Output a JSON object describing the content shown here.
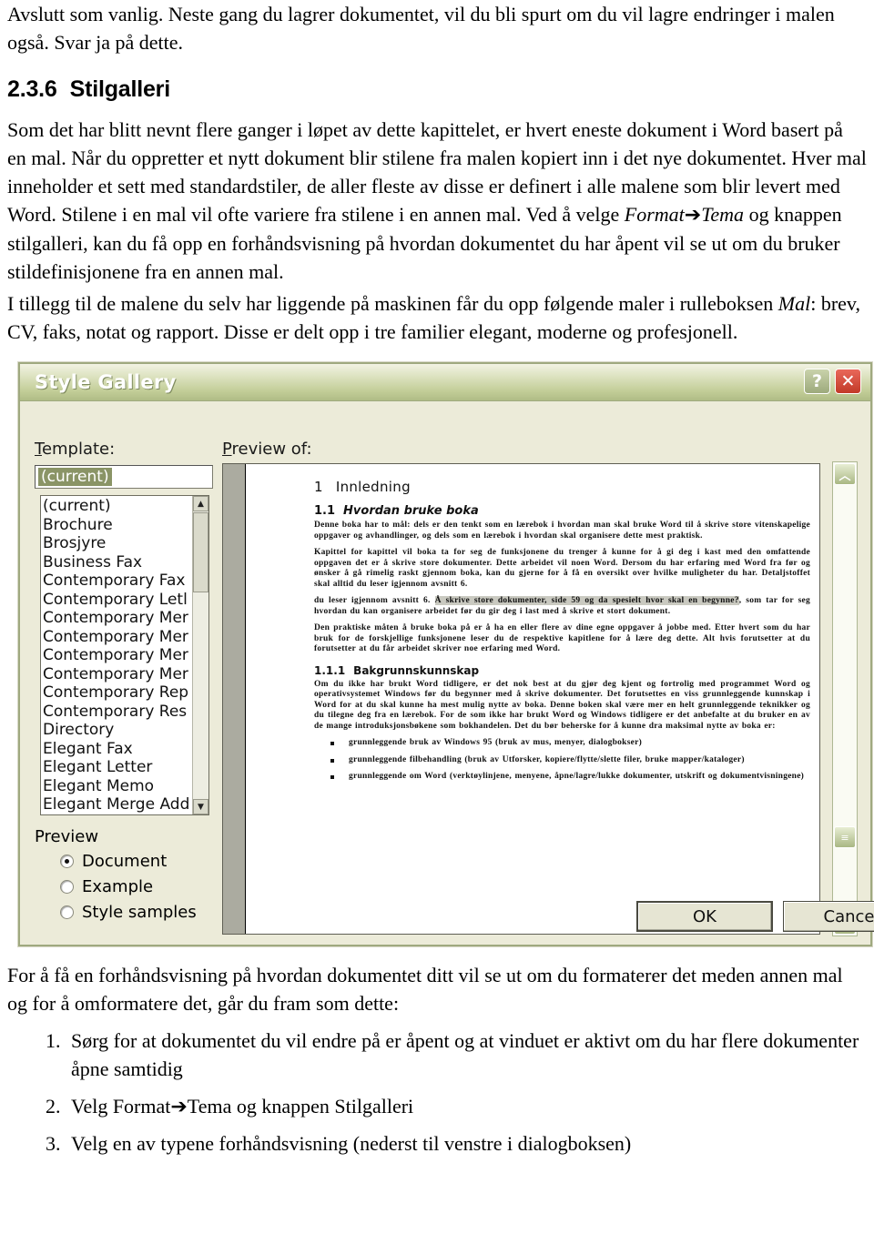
{
  "document": {
    "intro_paragraph": "Avslutt som vanlig. Neste gang du lagrer dokumentet, vil du bli spurt om du vil lagre endringer i malen også. Svar ja på dette.",
    "heading": {
      "number": "2.3.6",
      "title": "Stilgalleri"
    },
    "body_1_a": "Som det har blitt nevnt flere ganger i løpet av dette kapittelet, er hvert eneste dokument i Word basert på en mal. Når du oppretter et nytt dokument blir stilene fra malen kopiert inn i det nye dokumentet. Hver mal inneholder et sett med standardstiler, de aller fleste av disse er definert i alle malene som blir levert med Word. Stilene i en mal vil ofte variere fra stilene i en annen mal. Ved å velge ",
    "body_1_fmt": "Format",
    "body_1_arrow": "➔",
    "body_1_tema": "Tema",
    "body_1_b": " og knappen stilgalleri, kan du få opp en forhåndsvisning på hvordan dokumentet du har åpent vil se ut om du bruker stildefinisjonene fra en annen mal.",
    "body_2_a": "I tillegg til de malene du selv har liggende på maskinen får du opp følgende maler i rulleboksen ",
    "body_2_mal": "Mal",
    "body_2_b": ": brev, CV, faks, notat og rapport. Disse er delt opp i tre familier elegant, moderne og profesjonell.",
    "after_image_paragraph": "For å få en forhåndsvisning på hvordan dokumentet ditt vil se ut om du formaterer det meden annen mal og for å omformatere det, går du fram som dette:",
    "steps": [
      "Sørg for at dokumentet du vil endre på er åpent og at vinduet er aktivt om du har flere dokumenter åpne samtidig",
      "Velg Format➔Tema og knappen Stilgalleri",
      "Velg en av typene forhåndsvisning (nederst til venstre i dialogboksen)"
    ]
  },
  "dialog": {
    "title": "Style Gallery",
    "help_button": "?",
    "close_button": "✕",
    "template_label": "Template:",
    "template_value": "(current)",
    "preview_of_label": "Preview of:",
    "template_list": [
      "(current)",
      "Brochure",
      "Brosjyre",
      "Business Fax",
      "Contemporary Fax",
      "Contemporary Letl",
      "Contemporary Mer",
      "Contemporary Mer",
      "Contemporary Mer",
      "Contemporary Mer",
      "Contemporary Rep",
      "Contemporary Res",
      "Directory",
      "Elegant Fax",
      "Elegant Letter",
      "Elegant Memo",
      "Elegant Merge Add"
    ],
    "preview_group_label": "Preview",
    "preview_options": [
      {
        "label": "Document",
        "selected": true
      },
      {
        "label": "Example",
        "selected": false
      },
      {
        "label": "Style samples",
        "selected": false
      }
    ],
    "buttons": {
      "ok": "OK",
      "cancel": "Cancel"
    },
    "scroll_up": "︿",
    "scroll_down": "﹀",
    "scroll_thumb": "≡",
    "list_scroll_up": "▲",
    "list_scroll_down": "▼",
    "preview_document": {
      "h1_number": "1",
      "h1_title": "Innledning",
      "h2_number": "1.1",
      "h2_title": "Hvordan bruke boka",
      "p1": "Denne boka har to mål: dels er den tenkt som en lærebok i hvordan man skal bruke Word til å skrive store vitenskapelige oppgaver og avhandlinger, og dels som en lærebok i hvordan skal organisere dette mest praktisk.",
      "p2": "Kapittel for kapittel vil boka ta for seg de funksjonene du trenger å kunne for å gi deg i kast med den omfattende oppgaven det er å skrive store dokumenter. Dette arbeidet vil noen Word. Dersom du har erfaring med Word fra før og ønsker å gå rimelig raskt gjennom boka, kan du gjerne for å få en oversikt over hvilke muligheter du har. Detaljstoffet skal alltid du leser igjennom avsnitt 6.",
      "p3_pre": "du leser igjennom avsnitt 6. ",
      "p3_hl": "Å skrive store dokumenter, side 59 og da spesielt hvor skal en begynne?",
      "p3_post": ", som tar for seg hvordan du kan organisere arbeidet før du gir deg i last med å skrive et stort dokument.",
      "p4": "Den praktiske måten å bruke boka på er å ha en eller flere av dine egne oppgaver å jobbe med. Etter hvert som du har bruk for de forskjellige funksjonene leser du de respektive kapitlene for å lære deg dette. Alt hvis forutsetter at du forutsetter at du får arbeidet skriver noe erfaring med Word.",
      "h3_number": "1.1.1",
      "h3_title": "Bakgrunnskunnskap",
      "p5": "Om du ikke har brukt Word tidligere, er det nok best at du gjør deg kjent og fortrolig med programmet Word og operativsystemet Windows før du begynner med å skrive dokumenter. Det forutsettes en viss grunnleggende kunnskap i Word for at du skal kunne ha mest mulig nytte av boka. Denne boken skal være mer en helt grunnleggende teknikker og du tilegne deg fra en lærebok. For de som ikke har brukt Word og Windows tidligere er det anbefalte at du bruker en av de mange introduksjonsbøkene som bokhandelen. Det du bør beherske for å kunne dra maksimal nytte av boka er:",
      "bullets": [
        "grunnleggende bruk av Windows 95 (bruk av mus, menyer, dialogbokser)",
        "grunnleggende filbehandling (bruk av Utforsker, kopiere/flytte/slette filer, bruke mapper/kataloger)",
        "grunnleggende om Word (verktøylinjene, menyene, åpne/lagre/lukke dokumenter, utskrift og dokumentvisningene)"
      ]
    }
  }
}
